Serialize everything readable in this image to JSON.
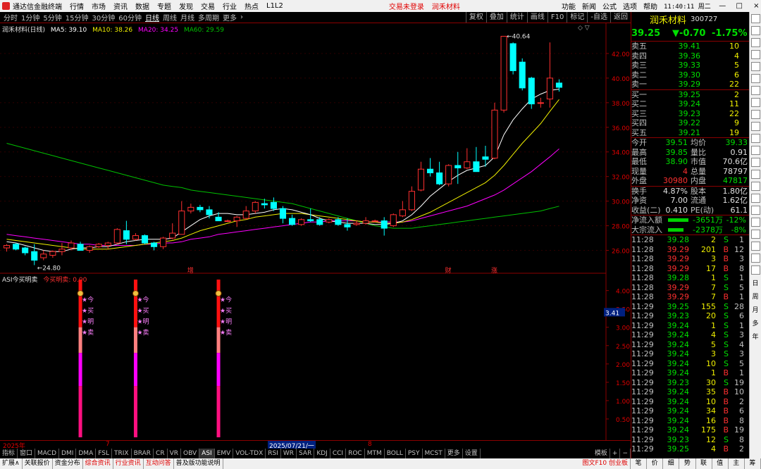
{
  "menubar": {
    "app_title": "通达信金融终端",
    "items": [
      "行情",
      "市场",
      "资讯",
      "数据",
      "专题",
      "发现",
      "交易",
      "行业",
      "热点",
      "L1L2"
    ],
    "login_status": "交易未登录",
    "stock": "润禾材料",
    "right_items": [
      "功能",
      "新闻",
      "公式",
      "选项",
      "帮助"
    ],
    "clock": "11:40:11 周二",
    "min": "—",
    "max": "□",
    "close": "×"
  },
  "periods": {
    "items": [
      "分时",
      "1分钟",
      "5分钟",
      "15分钟",
      "30分钟",
      "60分钟",
      "日线",
      "周线",
      "月线",
      "多周期",
      "更多"
    ],
    "selected": "日线",
    "more_arrow": "›"
  },
  "tools": [
    "复权",
    "叠加",
    "统计",
    "画线",
    "F10",
    "标记",
    "-自选",
    "返回"
  ],
  "main_legend": {
    "title": "润禾材料(日线)",
    "ma5": "MA5: 39.10",
    "ma10": "MA10: 38.26",
    "ma20": "MA20: 34.25",
    "ma60": "MA60: 29.59",
    "arrows": "◇ ▽"
  },
  "sub_legend": {
    "title": "ASI今买明卖",
    "value": "今买明卖: 0.00",
    "current_value": "3.41"
  },
  "colors": {
    "up": "#ff3030",
    "down": "#00ffff",
    "ma5": "#ffffff",
    "ma10": "#f0f000",
    "ma20": "#ff00ff",
    "ma60": "#00c000",
    "grid": "#8b0000"
  },
  "chart_data": [
    {
      "type": "candlestick",
      "name": "润禾材料(日线)",
      "ylim": [
        25,
        44
      ],
      "yticks": [
        26.0,
        28.0,
        30.0,
        32.0,
        34.0,
        36.0,
        38.0,
        40.0,
        42.0
      ],
      "ohlc": [
        [
          26.2,
          26.5,
          25.9,
          26.4
        ],
        [
          26.5,
          26.6,
          26.0,
          26.1
        ],
        [
          26.2,
          26.3,
          25.6,
          25.8
        ],
        [
          25.9,
          26.5,
          24.8,
          25.2
        ],
        [
          25.4,
          26.0,
          25.2,
          25.7
        ],
        [
          25.6,
          26.0,
          25.4,
          25.9
        ],
        [
          25.9,
          26.6,
          25.6,
          26.1
        ],
        [
          26.2,
          26.8,
          26.0,
          26.6
        ],
        [
          26.5,
          26.7,
          26.0,
          26.0
        ],
        [
          26.0,
          26.4,
          25.8,
          26.3
        ],
        [
          26.3,
          26.6,
          26.2,
          26.5
        ],
        [
          26.4,
          26.7,
          26.1,
          26.6
        ],
        [
          26.6,
          27.8,
          26.5,
          27.7
        ],
        [
          27.6,
          28.4,
          26.5,
          26.9
        ],
        [
          26.9,
          27.4,
          26.8,
          27.2
        ],
        [
          27.2,
          27.3,
          26.5,
          26.6
        ],
        [
          26.6,
          26.7,
          26.0,
          26.3
        ],
        [
          26.3,
          27.1,
          26.1,
          27.0
        ],
        [
          27.0,
          28.2,
          26.9,
          27.4
        ],
        [
          27.3,
          30.0,
          27.3,
          29.2
        ],
        [
          29.2,
          29.8,
          29.0,
          29.5
        ],
        [
          29.5,
          29.7,
          29.1,
          29.3
        ],
        [
          29.3,
          29.6,
          28.6,
          28.9
        ],
        [
          28.7,
          29.1,
          28.4,
          28.4
        ],
        [
          28.4,
          28.5,
          28.3,
          28.4
        ],
        [
          28.4,
          28.8,
          27.9,
          28.7
        ],
        [
          28.6,
          29.6,
          28.5,
          29.2
        ],
        [
          29.2,
          30.0,
          29.0,
          29.9
        ],
        [
          29.8,
          30.2,
          29.4,
          29.7
        ],
        [
          29.9,
          30.3,
          29.2,
          29.4
        ],
        [
          29.4,
          29.6,
          28.2,
          28.6
        ],
        [
          28.6,
          28.9,
          28.0,
          28.1
        ],
        [
          28.1,
          28.6,
          28.0,
          28.5
        ],
        [
          28.5,
          29.4,
          28.3,
          28.4
        ],
        [
          28.5,
          28.7,
          28.0,
          28.1
        ],
        [
          28.3,
          28.6,
          28.2,
          28.5
        ],
        [
          28.5,
          28.7,
          28.0,
          28.1
        ],
        [
          28.1,
          28.6,
          27.6,
          27.9
        ],
        [
          28.1,
          28.4,
          28.0,
          28.2
        ],
        [
          28.2,
          28.7,
          28.1,
          28.4
        ],
        [
          28.4,
          28.5,
          28.3,
          28.4
        ],
        [
          28.4,
          28.7,
          27.2,
          27.8
        ],
        [
          28.0,
          29.0,
          27.9,
          28.9
        ],
        [
          28.8,
          30.0,
          28.7,
          29.3
        ],
        [
          29.3,
          31.2,
          29.2,
          30.8
        ],
        [
          30.9,
          33.2,
          30.8,
          32.6
        ],
        [
          32.6,
          33.5,
          32.0,
          32.3
        ],
        [
          32.3,
          33.2,
          31.3,
          31.4
        ],
        [
          31.4,
          33.0,
          31.2,
          32.9
        ],
        [
          32.9,
          34.0,
          31.4,
          32.7
        ],
        [
          32.7,
          34.3,
          32.6,
          33.2
        ],
        [
          33.2,
          34.4,
          32.4,
          32.4
        ],
        [
          33.6,
          34.5,
          32.8,
          33.4
        ],
        [
          33.5,
          38.0,
          33.4,
          37.4
        ],
        [
          37.4,
          43.4,
          37.2,
          43.4
        ],
        [
          42.8,
          42.9,
          40.3,
          40.6
        ],
        [
          41.3,
          41.6,
          39.0,
          39.2
        ],
        [
          40.0,
          40.1,
          37.5,
          37.9
        ],
        [
          38.0,
          38.4,
          37.6,
          38.0
        ],
        [
          38.3,
          42.9,
          37.6,
          40.0
        ],
        [
          39.6,
          39.9,
          38.9,
          39.25
        ]
      ],
      "ma5": [
        26.7,
        26.6,
        26.4,
        26.2,
        26.0,
        25.9,
        25.9,
        26.1,
        26.2,
        26.2,
        26.3,
        26.3,
        26.5,
        26.7,
        26.8,
        26.9,
        26.9,
        26.9,
        27.0,
        27.5,
        28.0,
        28.5,
        28.8,
        29.0,
        29.0,
        28.9,
        28.9,
        29.0,
        29.1,
        29.3,
        29.4,
        29.3,
        29.1,
        28.9,
        28.6,
        28.4,
        28.3,
        28.2,
        28.2,
        28.2,
        28.1,
        28.1,
        28.2,
        28.4,
        28.9,
        29.6,
        30.4,
        31.0,
        31.6,
        32.1,
        32.5,
        32.7,
        32.9,
        33.6,
        35.4,
        36.6,
        37.5,
        38.3,
        38.7,
        39.0,
        39.1
      ],
      "ma10": [
        26.9,
        26.8,
        26.7,
        26.6,
        26.5,
        26.4,
        26.3,
        26.2,
        26.1,
        26.1,
        26.1,
        26.1,
        26.2,
        26.3,
        26.4,
        26.5,
        26.6,
        26.7,
        26.8,
        27.0,
        27.3,
        27.6,
        27.8,
        28.0,
        28.2,
        28.4,
        28.5,
        28.7,
        28.8,
        28.9,
        29.0,
        29.0,
        29.0,
        28.9,
        28.8,
        28.7,
        28.6,
        28.5,
        28.4,
        28.3,
        28.3,
        28.2,
        28.2,
        28.3,
        28.5,
        28.8,
        29.1,
        29.5,
        29.9,
        30.3,
        30.7,
        31.1,
        31.5,
        32.1,
        32.9,
        33.8,
        34.7,
        35.5,
        36.3,
        37.3,
        38.26
      ],
      "ma20": [
        27.3,
        27.2,
        27.1,
        27.0,
        26.9,
        26.8,
        26.7,
        26.6,
        26.5,
        26.5,
        26.4,
        26.4,
        26.4,
        26.4,
        26.4,
        26.5,
        26.5,
        26.6,
        26.6,
        26.7,
        26.9,
        27.0,
        27.1,
        27.3,
        27.4,
        27.5,
        27.6,
        27.7,
        27.8,
        27.9,
        28.0,
        28.1,
        28.2,
        28.3,
        28.3,
        28.4,
        28.4,
        28.4,
        28.4,
        28.3,
        28.3,
        28.3,
        28.3,
        28.3,
        28.4,
        28.6,
        28.8,
        29.0,
        29.2,
        29.4,
        29.6,
        29.9,
        30.2,
        30.5,
        30.9,
        31.4,
        31.9,
        32.4,
        33.0,
        33.6,
        34.25
      ],
      "ma60": [
        34.7,
        34.5,
        34.3,
        34.1,
        33.9,
        33.7,
        33.5,
        33.3,
        33.1,
        32.9,
        32.7,
        32.5,
        32.3,
        32.1,
        31.9,
        31.7,
        31.5,
        31.3,
        31.2,
        31.1,
        30.9,
        30.8,
        30.7,
        30.6,
        30.5,
        30.4,
        30.3,
        30.2,
        30.1,
        30.0,
        29.9,
        29.8,
        29.6,
        29.4,
        29.2,
        29.0,
        28.8,
        28.6,
        28.4,
        28.2,
        28.0,
        27.9,
        27.8,
        27.8,
        27.8,
        27.9,
        28.0,
        28.1,
        28.2,
        28.3,
        28.4,
        28.5,
        28.6,
        28.7,
        28.8,
        28.9,
        29.0,
        29.1,
        29.2,
        29.4,
        29.59
      ],
      "annotations": [
        {
          "label": "40.64",
          "index": 54,
          "value": 43.4
        },
        {
          "label": "24.80",
          "index": 3,
          "value": 24.8
        }
      ],
      "markers": [
        {
          "label": "增",
          "index": 20
        },
        {
          "label": "财",
          "index": 48
        },
        {
          "label": "涨",
          "index": 53
        }
      ]
    },
    {
      "type": "bar",
      "name": "ASI今买明卖",
      "ylim": [
        0,
        4.3
      ],
      "yticks": [
        0.5,
        1.0,
        1.5,
        2.0,
        2.5,
        3.0,
        3.5,
        4.0
      ],
      "signal_indices": [
        8,
        14,
        23
      ],
      "signal_labels": [
        "★今",
        "★买",
        "★明",
        "★卖"
      ]
    }
  ],
  "xaxis": {
    "labels": [
      "2025年",
      "7",
      "2025/07/21/一",
      "8"
    ]
  },
  "indicators": [
    "指标",
    "窗口",
    "MACD",
    "DMI",
    "DMA",
    "FSL",
    "TRIX",
    "BRAR",
    "CR",
    "VR",
    "OBV",
    "ASI",
    "EMV",
    "VOL-TDX",
    "RSI",
    "WR",
    "SAR",
    "KDJ",
    "CCI",
    "ROC",
    "MTM",
    "BOLL",
    "PSY",
    "MCST",
    "更多",
    "设置",
    "模板",
    "+",
    "−"
  ],
  "bottom_tabs": [
    "扩展∧",
    "关联报价",
    "资金分布",
    "综合资讯",
    "行业资讯",
    "互动问答",
    "普及版功能说明"
  ],
  "bottom_f10": "图文F10 创业板",
  "quote": {
    "name": "润禾材料",
    "code": "300727",
    "price": "39.25",
    "change": "▼-0.70",
    "pct": "-1.75%",
    "asks": [
      {
        "label": "卖五",
        "price": "39.41",
        "vol": "10"
      },
      {
        "label": "卖四",
        "price": "39.36",
        "vol": "4"
      },
      {
        "label": "卖三",
        "price": "39.33",
        "vol": "5"
      },
      {
        "label": "卖二",
        "price": "39.30",
        "vol": "6"
      },
      {
        "label": "卖一",
        "price": "39.29",
        "vol": "22"
      }
    ],
    "bids": [
      {
        "label": "买一",
        "price": "39.25",
        "vol": "2"
      },
      {
        "label": "买二",
        "price": "39.24",
        "vol": "11"
      },
      {
        "label": "买三",
        "price": "39.23",
        "vol": "22"
      },
      {
        "label": "买四",
        "price": "39.22",
        "vol": "9"
      },
      {
        "label": "买五",
        "price": "39.21",
        "vol": "19"
      }
    ],
    "stats": [
      [
        "今开",
        "39.51",
        "均价",
        "39.33"
      ],
      [
        "最高",
        "39.85",
        "量比",
        "0.91"
      ],
      [
        "最低",
        "38.90",
        "市值",
        "70.6亿"
      ],
      [
        "现量",
        "4",
        "总量",
        "78797"
      ],
      [
        "外盘",
        "30980",
        "内盘",
        "47817"
      ],
      [
        "换手",
        "4.87%",
        "股本",
        "1.80亿"
      ],
      [
        "净资",
        "7.00",
        "流通",
        "1.62亿"
      ],
      [
        "收益(二)",
        "0.410",
        "PE(动)",
        "61.1"
      ]
    ],
    "flows": [
      {
        "label": "净流入额",
        "value": "-3651万",
        "pct": "-12%",
        "level": 0.9
      },
      {
        "label": "大宗流入",
        "value": "-2378万",
        "pct": "-8%",
        "level": 0.7
      }
    ],
    "ticks": [
      [
        "11:28",
        "39.28",
        "2",
        "S",
        "1"
      ],
      [
        "11:28",
        "39.29",
        "201",
        "B",
        "12"
      ],
      [
        "11:28",
        "39.29",
        "3",
        "B",
        "3"
      ],
      [
        "11:28",
        "39.29",
        "17",
        "B",
        "8"
      ],
      [
        "11:28",
        "39.28",
        "1",
        "S",
        "1"
      ],
      [
        "11:28",
        "39.29",
        "7",
        "S",
        "5"
      ],
      [
        "11:28",
        "39.29",
        "7",
        "B",
        "1"
      ],
      [
        "11:29",
        "39.25",
        "155",
        "S",
        "28"
      ],
      [
        "11:29",
        "39.23",
        "20",
        "S",
        "6"
      ],
      [
        "11:29",
        "39.24",
        "1",
        "S",
        "1"
      ],
      [
        "11:29",
        "39.24",
        "4",
        "S",
        "3"
      ],
      [
        "11:29",
        "39.24",
        "5",
        "S",
        "4"
      ],
      [
        "11:29",
        "39.24",
        "3",
        "S",
        "3"
      ],
      [
        "11:29",
        "39.24",
        "10",
        "S",
        "5"
      ],
      [
        "11:29",
        "39.24",
        "1",
        "B",
        "1"
      ],
      [
        "11:29",
        "39.23",
        "30",
        "S",
        "19"
      ],
      [
        "11:29",
        "39.24",
        "35",
        "B",
        "10"
      ],
      [
        "11:29",
        "39.24",
        "10",
        "B",
        "2"
      ],
      [
        "11:29",
        "39.24",
        "34",
        "B",
        "6"
      ],
      [
        "11:29",
        "39.24",
        "16",
        "B",
        "8"
      ],
      [
        "11:29",
        "39.24",
        "175",
        "B",
        "19"
      ],
      [
        "11:29",
        "39.23",
        "12",
        "S",
        "8"
      ],
      [
        "11:29",
        "39.25",
        "4",
        "B",
        "2"
      ]
    ]
  },
  "sidebar": [
    "日",
    "周",
    "月",
    "多",
    "年"
  ],
  "rbottom": [
    "笔",
    "价",
    "细",
    "势",
    "联",
    "值",
    "主",
    "筹"
  ]
}
